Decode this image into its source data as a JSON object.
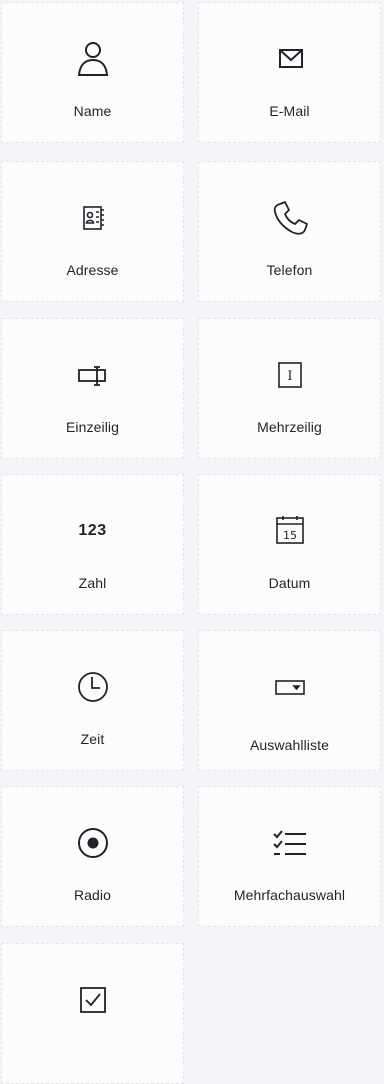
{
  "fields": [
    {
      "icon": "person-icon",
      "label": "Name"
    },
    {
      "icon": "envelope-icon",
      "label": "E-Mail"
    },
    {
      "icon": "address-book-icon",
      "label": "Adresse"
    },
    {
      "icon": "phone-icon",
      "label": "Telefon"
    },
    {
      "icon": "single-line-input-icon",
      "label": "Einzeilig"
    },
    {
      "icon": "text-area-icon",
      "label": "Mehrzeilig"
    },
    {
      "icon": "number-icon",
      "label": "Zahl",
      "icon_text": "123"
    },
    {
      "icon": "calendar-icon",
      "label": "Datum",
      "icon_text": "15"
    },
    {
      "icon": "clock-icon",
      "label": "Zeit"
    },
    {
      "icon": "dropdown-icon",
      "label": "Auswahlliste"
    },
    {
      "icon": "radio-icon",
      "label": "Radio"
    },
    {
      "icon": "checklist-icon",
      "label": "Mehrfachauswahl"
    },
    {
      "icon": "checkbox-icon",
      "label": ""
    }
  ],
  "textarea_icon_glyph": "I",
  "colors": {
    "background": "#f4f5f9",
    "tile": "#fcfcfd",
    "tile_border": "#e3e5ec",
    "text": "#1f2329"
  }
}
